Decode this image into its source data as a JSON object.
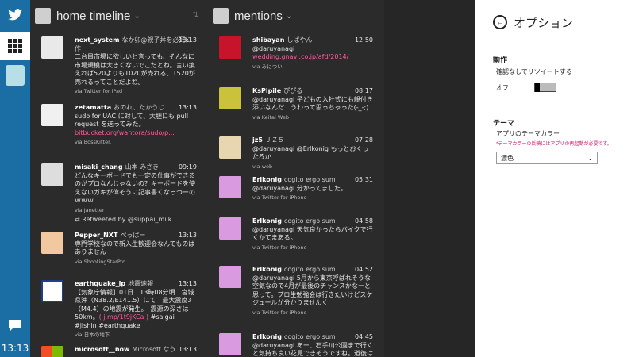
{
  "clock": "13:13",
  "columns": {
    "timeline_title": "home timeline",
    "mentions_title": "mentions"
  },
  "timeline": [
    {
      "name": "next_system",
      "sub": "なか卯@親子丼を必死に作",
      "time": "13:13",
      "text": "二台目市場に欲しいと言っても、そんなに市場規模は大きくないでこだとね。言い換えれば520よりも1020が売れる、1520が売れるってことだよね。",
      "link": "",
      "after": "",
      "via": "via Twitter for iPad",
      "rt": ""
    },
    {
      "name": "zetamatta",
      "sub": "おのれ、たかうじ",
      "time": "13:13",
      "text": "sudo for UAC に対して、大胆にも pull request を送ってみた。",
      "link": "bitbucket.org/wantora/sudo/p...",
      "after": "",
      "via": "via BossKitter.",
      "rt": ""
    },
    {
      "name": "misaki_chang",
      "sub": "山本 みさき",
      "time": "09:19",
      "text": "どんなキーボードでも一定の仕事ができるのがプロなんじゃないの？キーボードを使えないガキが偉そうに記事書くなっつーのｗｗｗ",
      "link": "",
      "after": "",
      "via": "via Janetter",
      "rt": "Retweeted by @suppai_milk"
    },
    {
      "name": "Pepper_NXT",
      "sub": "ぺっぱー",
      "time": "13:13",
      "text": "専門学校なので新入生歓迎会なんてものはありません",
      "link": "",
      "after": "",
      "via": "via ShootingStarPro",
      "rt": ""
    },
    {
      "name": "earthquake_jp",
      "sub": "地震速報",
      "time": "13:13",
      "text": "【気象庁情報】01日　13時08分頃　宮城県沖（N38.2/E141.5）にて　最大震度3（M4.4）の地震が発生。　震源の深さは50km。",
      "link": "( j.mp/1t9jKCa )",
      "after": " #saigai #jishin #earthquake",
      "via": "via 日本の地下",
      "rt": ""
    },
    {
      "name": "microsoft__now",
      "sub": "Microsoft なう",
      "time": "13:13",
      "text": "",
      "link": "",
      "after": "",
      "via": "",
      "rt": ""
    }
  ],
  "mentions": [
    {
      "name": "shibayan",
      "sub": "しばやん",
      "time": "12:50",
      "text": "@daruyanagi",
      "link": "wedding.gnavi.co.jp/afd/2014/",
      "after": "",
      "via": "via みについ"
    },
    {
      "name": "KsPipile",
      "sub": "ぴぴる",
      "time": "08:17",
      "text": "@daruyanagi 子どもの入社式にも親付き添いなんだ…うわって思っちゃった(-_-;)",
      "link": "",
      "after": "",
      "via": "via Keitai Web"
    },
    {
      "name": "jz5",
      "sub": "ＪＺ５",
      "time": "07:28",
      "text": "@daruyanagi @Erlkonig もっとおくったろか",
      "link": "",
      "after": "",
      "via": "via web"
    },
    {
      "name": "Erlkonig",
      "sub": "cogito ergo sum",
      "time": "05:31",
      "text": "@daruyanagi 分かってました。",
      "link": "",
      "after": "",
      "via": "via Twitter for iPhone"
    },
    {
      "name": "Erlkonig",
      "sub": "cogito ergo sum",
      "time": "04:58",
      "text": "@daruyanagi 天気良かったらバイクで行くかてまある。",
      "link": "",
      "after": "",
      "via": "via Twitter for iPhone"
    },
    {
      "name": "Erlkonig",
      "sub": "cogito ergo sum",
      "time": "04:52",
      "text": "@daruyanagi 5月から東京呼ばれそうな空気なので4月が最後のチャンスかなーと思って。プロ生勉強会は行きたいけどスケジュールが分かりませんく",
      "link": "",
      "after": "",
      "via": "via Twitter for iPhone"
    },
    {
      "name": "Erlkonig",
      "sub": "cogito ergo sum",
      "time": "04:45",
      "text": "@daruyanagi あー、石手川公園まで行くと気持ち良い花見できそうですね。道後はもうひとも…",
      "link": "",
      "after": "",
      "via": ""
    }
  ],
  "options": {
    "title": "オプション",
    "action_title": "動作",
    "retweet_confirm": "確認なしでリツイートする",
    "toggle_state": "オフ",
    "toggle_on": false,
    "theme_title": "テーマ",
    "theme_label": "アプリのテーマカラー",
    "theme_note": "*テーマカラーの反映にはアプリの再起動が必要です。",
    "theme_value": "濃色"
  },
  "colors": {
    "nav": "#1a6ea3",
    "link": "#ff5b9f",
    "note": "#d01060"
  }
}
